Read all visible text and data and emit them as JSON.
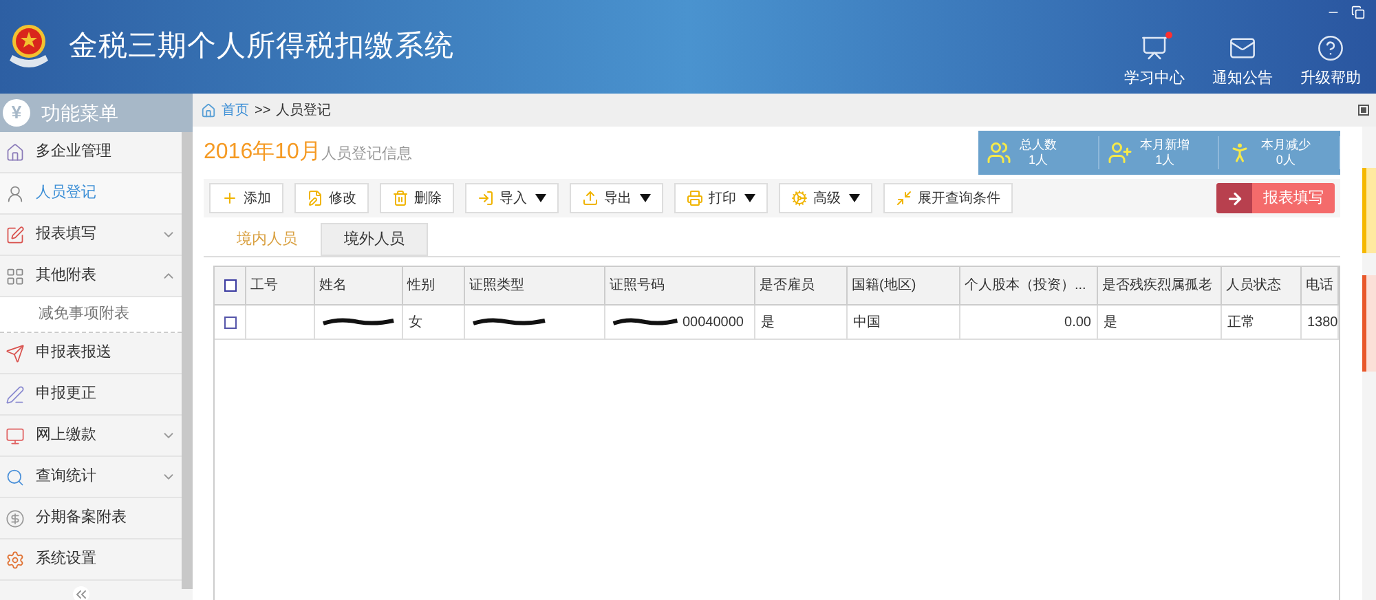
{
  "header": {
    "title": "金税三期个人所得税扣缴系统",
    "actions": [
      {
        "kind": "study",
        "label": "学习中心",
        "badge": true
      },
      {
        "kind": "mail",
        "label": "通知公告",
        "badge": false
      },
      {
        "kind": "help",
        "label": "升级帮助",
        "badge": false
      }
    ]
  },
  "sidebar": {
    "icon_text": "¥",
    "title": "功能菜单",
    "items": [
      {
        "kind": "company",
        "label": "多企业管理",
        "selected": false
      },
      {
        "kind": "person",
        "label": "人员登记",
        "selected": true
      },
      {
        "kind": "form",
        "label": "报表填写",
        "selected": false,
        "expandable": true,
        "expanded": false
      },
      {
        "kind": "grid",
        "label": "其他附表",
        "selected": false,
        "expandable": true,
        "expanded": true,
        "children": [
          {
            "label": "减免事项附表",
            "selected": false
          }
        ]
      },
      {
        "kind": "send",
        "label": "申报表报送",
        "selected": false
      },
      {
        "kind": "edit",
        "label": "申报更正",
        "selected": false
      },
      {
        "kind": "pay",
        "label": "网上缴款",
        "selected": false,
        "expandable": true,
        "expanded": false
      },
      {
        "kind": "search",
        "label": "查询统计",
        "selected": false,
        "expandable": true,
        "expanded": false
      },
      {
        "kind": "installment",
        "label": "分期备案附表",
        "selected": false
      },
      {
        "kind": "settings",
        "label": "系统设置",
        "selected": false
      }
    ]
  },
  "breadcrumb": {
    "home": "首页",
    "separator": ">>",
    "current": "人员登记"
  },
  "page": {
    "period": "2016年10月",
    "title": "人员登记信息"
  },
  "stats": [
    {
      "kind": "total",
      "label": "总人数",
      "value": "1人"
    },
    {
      "kind": "added",
      "label": "本月新增",
      "value": "1人"
    },
    {
      "kind": "reduced",
      "label": "本月减少",
      "value": "0人"
    }
  ],
  "toolbar": [
    {
      "kind": "add",
      "label": "添加",
      "dropdown": false
    },
    {
      "kind": "edit",
      "label": "修改",
      "dropdown": false
    },
    {
      "kind": "delete",
      "label": "删除",
      "dropdown": false
    },
    {
      "kind": "import",
      "label": "导入",
      "dropdown": true
    },
    {
      "kind": "export",
      "label": "导出",
      "dropdown": true
    },
    {
      "kind": "print",
      "label": "打印",
      "dropdown": true
    },
    {
      "kind": "advanced",
      "label": "高级",
      "dropdown": true
    },
    {
      "kind": "expand",
      "label": "展开查询条件",
      "dropdown": false
    }
  ],
  "report_button": "报表填写",
  "tabs": [
    {
      "label": "境内人员",
      "selected": true
    },
    {
      "label": "境外人员",
      "selected": false
    }
  ],
  "table": {
    "select_all_checked": false,
    "columns": [
      "工号",
      "姓名",
      "性别",
      "证照类型",
      "证照号码",
      "是否雇员",
      "国籍(地区)",
      "个人股本（投资）...",
      "是否残疾烈属孤老",
      "人员状态",
      "电话"
    ],
    "rows": [
      {
        "checked": false,
        "cells": [
          {
            "text": "",
            "redacted": false
          },
          {
            "text": "",
            "redacted": true
          },
          {
            "text": "女",
            "redacted": false
          },
          {
            "text": "",
            "redacted": true
          },
          {
            "text": "00040000",
            "redacted": true
          },
          {
            "text": "是",
            "redacted": false
          },
          {
            "text": "中国",
            "redacted": false
          },
          {
            "text": "0.00",
            "redacted": false
          },
          {
            "text": "是",
            "redacted": false
          },
          {
            "text": "正常",
            "redacted": false
          },
          {
            "text": "1380",
            "redacted": false
          }
        ]
      }
    ]
  }
}
